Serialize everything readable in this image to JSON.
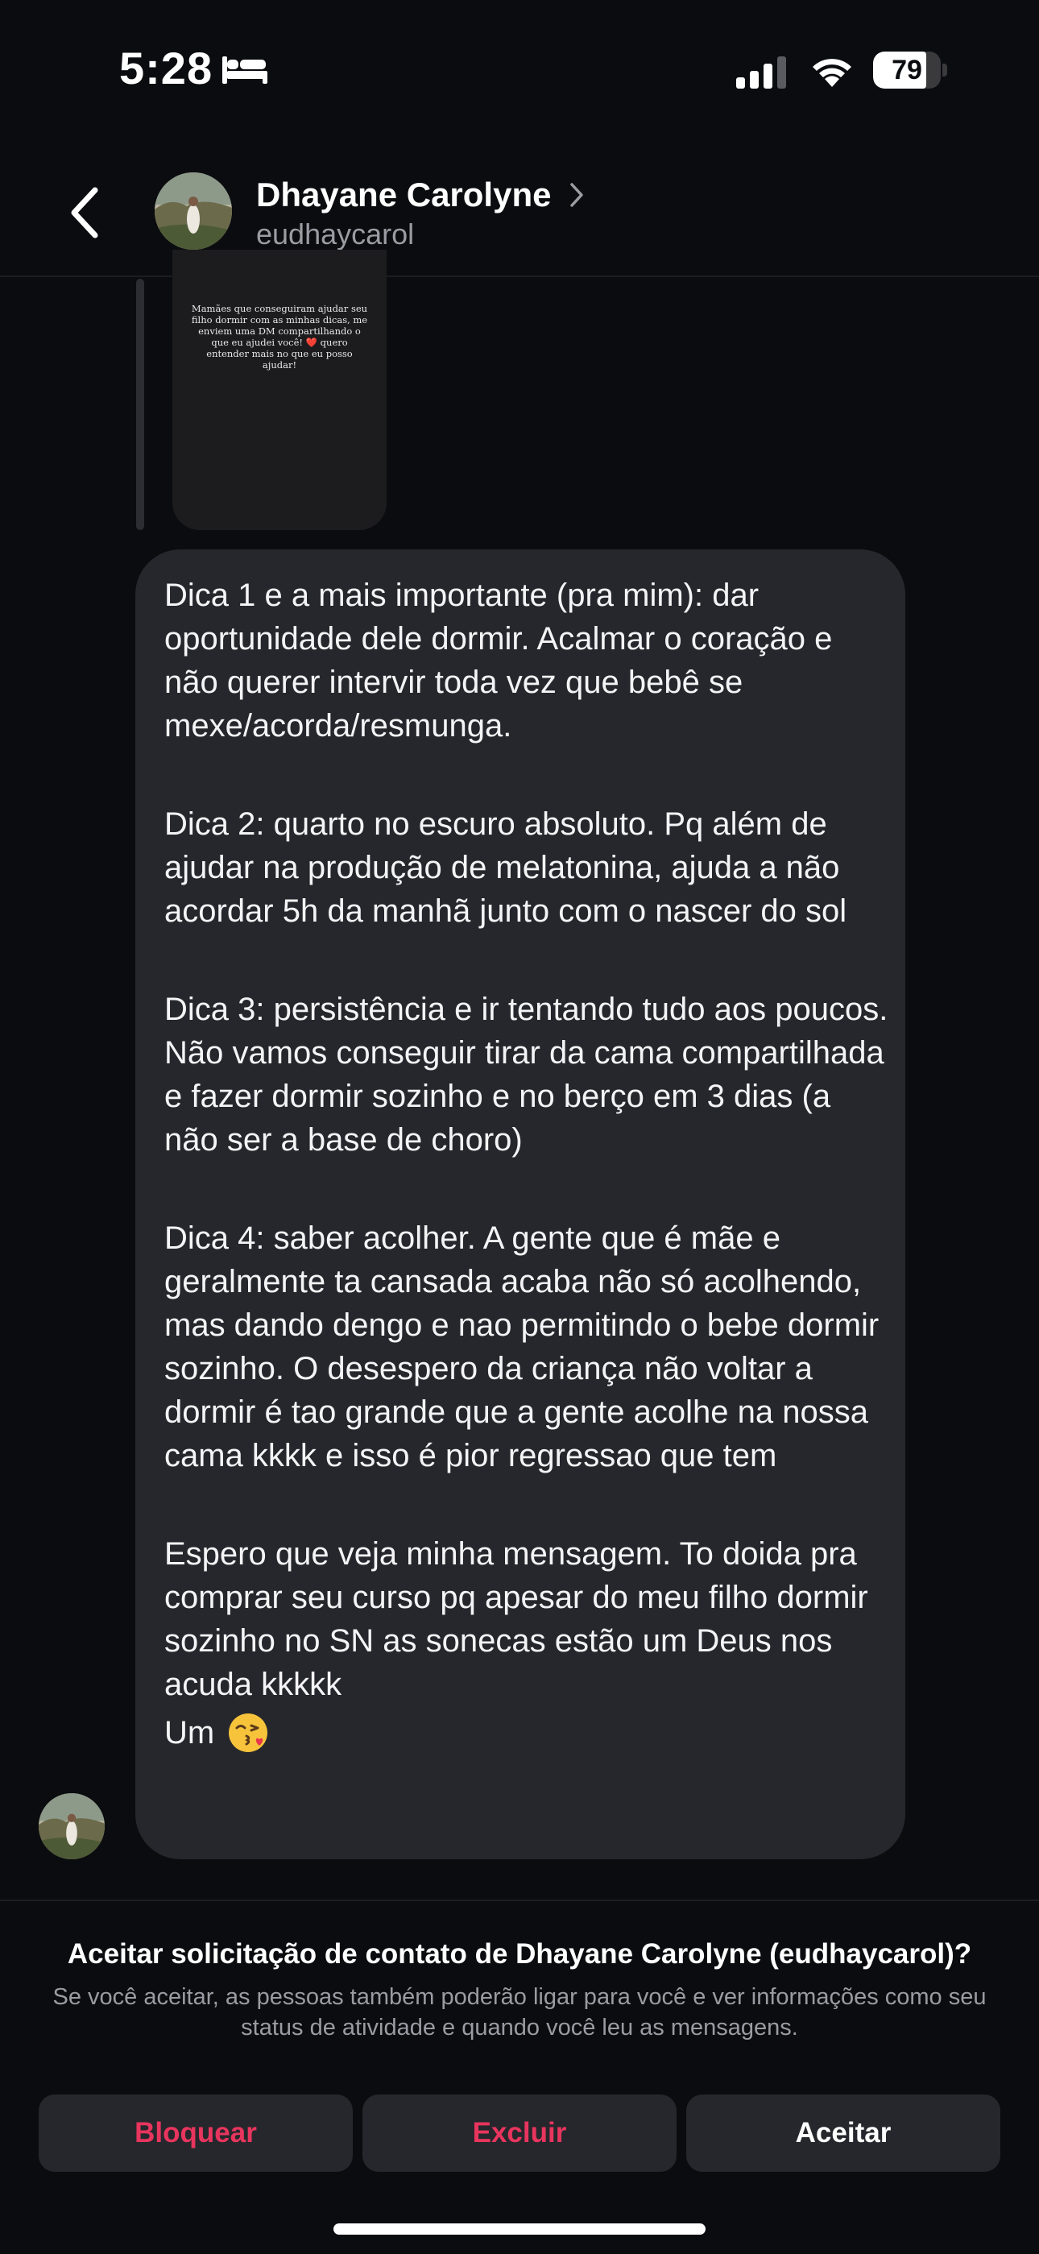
{
  "status_bar": {
    "time": "5:28",
    "battery_level": "79",
    "battery_fraction": 0.79,
    "icons": [
      "bed-icon",
      "signal-icon",
      "wifi-icon",
      "battery-icon"
    ]
  },
  "header": {
    "back_icon": "chevron-left-icon",
    "name": "Dhayane Carolyne",
    "username": "eudhaycarol",
    "chevron_icon": "chevron-right-icon"
  },
  "story": {
    "text": "Mamães que conseguiram ajudar seu filho dormir com as minhas dicas, me enviem uma DM compartilhando o que eu ajudei você! ❤️ quero entender mais no que eu posso ajudar!"
  },
  "message": {
    "paragraphs": [
      "Dica 1 e a mais importante (pra mim): dar oportunidade dele dormir. Acalmar o coração e não querer intervir toda vez que bebê se mexe/acorda/resmunga.",
      "Dica 2: quarto no escuro absoluto. Pq além de ajudar na produção de melatonina, ajuda a não acordar 5h da manhã junto com o nascer do sol",
      "Dica 3: persistência e ir tentando tudo aos poucos. Não vamos conseguir tirar da cama compartilhada e fazer dormir sozinho e no berço em 3 dias (a não ser a base de choro)",
      "Dica 4: saber acolher. A gente que é mãe e geralmente ta cansada acaba não só acolhendo, mas dando dengo e nao permitindo o bebe dormir sozinho.  O desespero da criança não voltar a dormir é tao grande que a gente acolhe na nossa cama kkkk e isso é pior regressao que tem",
      "Espero que veja minha mensagem. To doida pra comprar seu curso pq apesar do meu filho dormir sozinho no SN as sonecas estão um Deus nos acuda kkkkk"
    ],
    "last_line": "Um",
    "emoji_icon": "kiss-emoji-icon"
  },
  "request": {
    "title": "Aceitar solicitação de contato de Dhayane Carolyne (eudhaycarol)?",
    "description": "Se você aceitar, as pessoas também poderão ligar para você e ver informações como seu status de atividade e quando você leu as mensagens.",
    "block_label": "Bloquear",
    "delete_label": "Excluir",
    "accept_label": "Aceitar"
  },
  "colors": {
    "background": "#0b0c0f",
    "bubble": "#26272c",
    "danger": "#e8355e",
    "secondary_text": "#9a9ca3"
  }
}
